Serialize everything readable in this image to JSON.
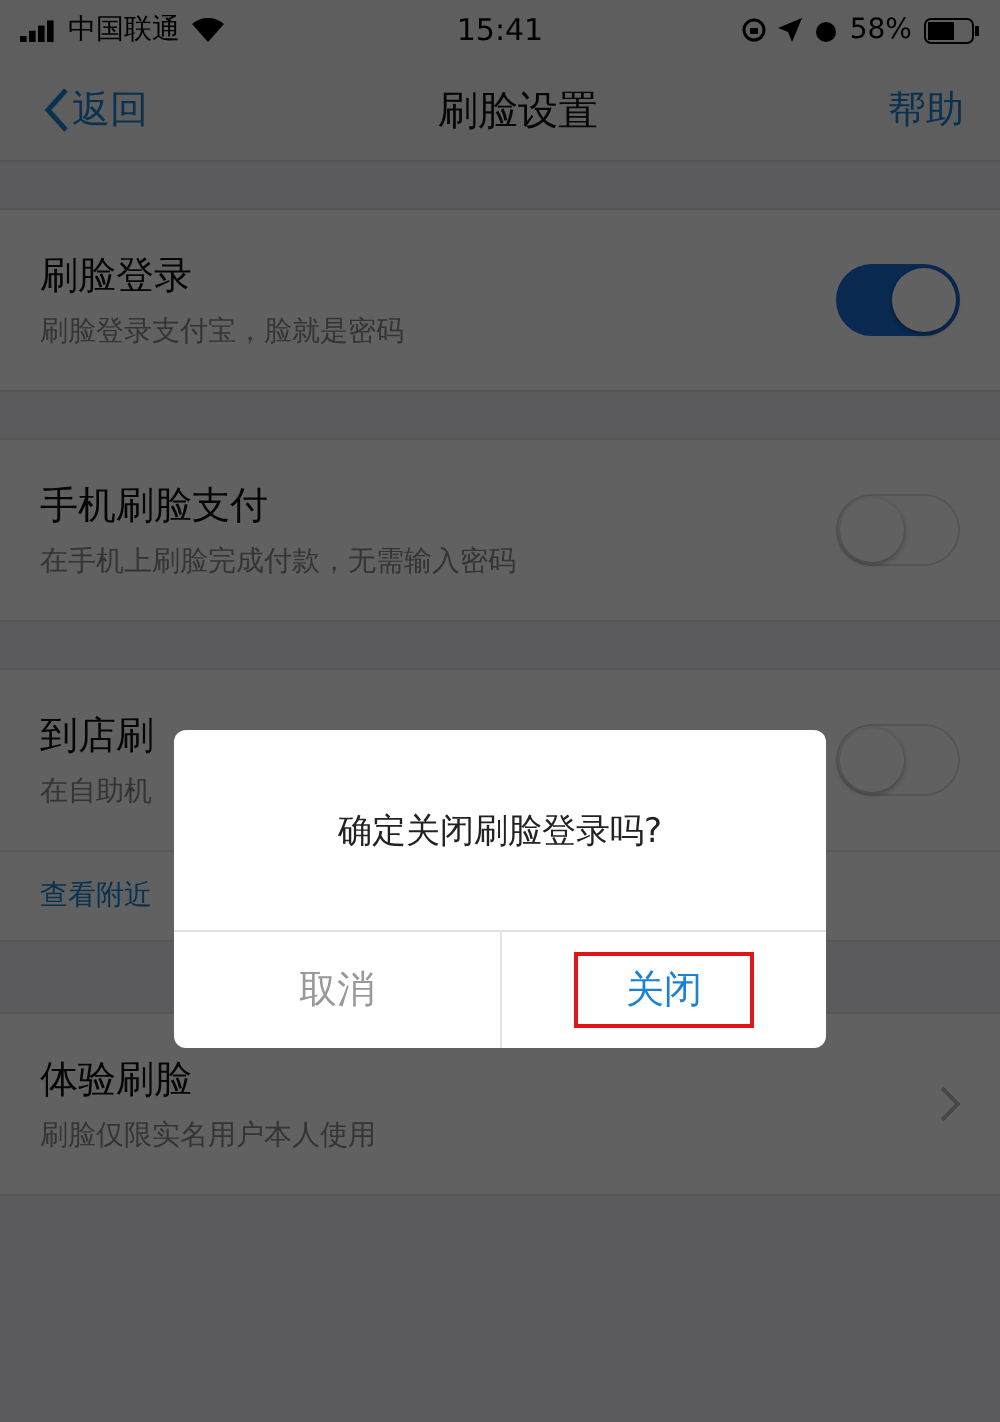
{
  "status_bar": {
    "carrier": "中国联通",
    "time": "15:41",
    "battery": "58%"
  },
  "nav": {
    "back": "返回",
    "title": "刷脸设置",
    "action": "帮助"
  },
  "sections": [
    {
      "kind": "toggle",
      "title": "刷脸登录",
      "subtitle": "刷脸登录支付宝，脸就是密码",
      "on": true
    },
    {
      "kind": "toggle",
      "title": "手机刷脸支付",
      "subtitle": "在手机上刷脸完成付款，无需输入密码",
      "on": false
    },
    {
      "kind": "toggle",
      "title": "到店刷",
      "subtitle": "在自助机",
      "on": false,
      "link": "查看附近"
    },
    {
      "kind": "chevron",
      "title": "体验刷脸",
      "subtitle": "刷脸仅限实名用户本人使用"
    }
  ],
  "dialog": {
    "message": "确定关闭刷脸登录吗?",
    "buttons": [
      {
        "label": "取消",
        "kind": "cancel",
        "highlighted": false
      },
      {
        "label": "关闭",
        "kind": "confirm",
        "highlighted": true
      }
    ]
  }
}
